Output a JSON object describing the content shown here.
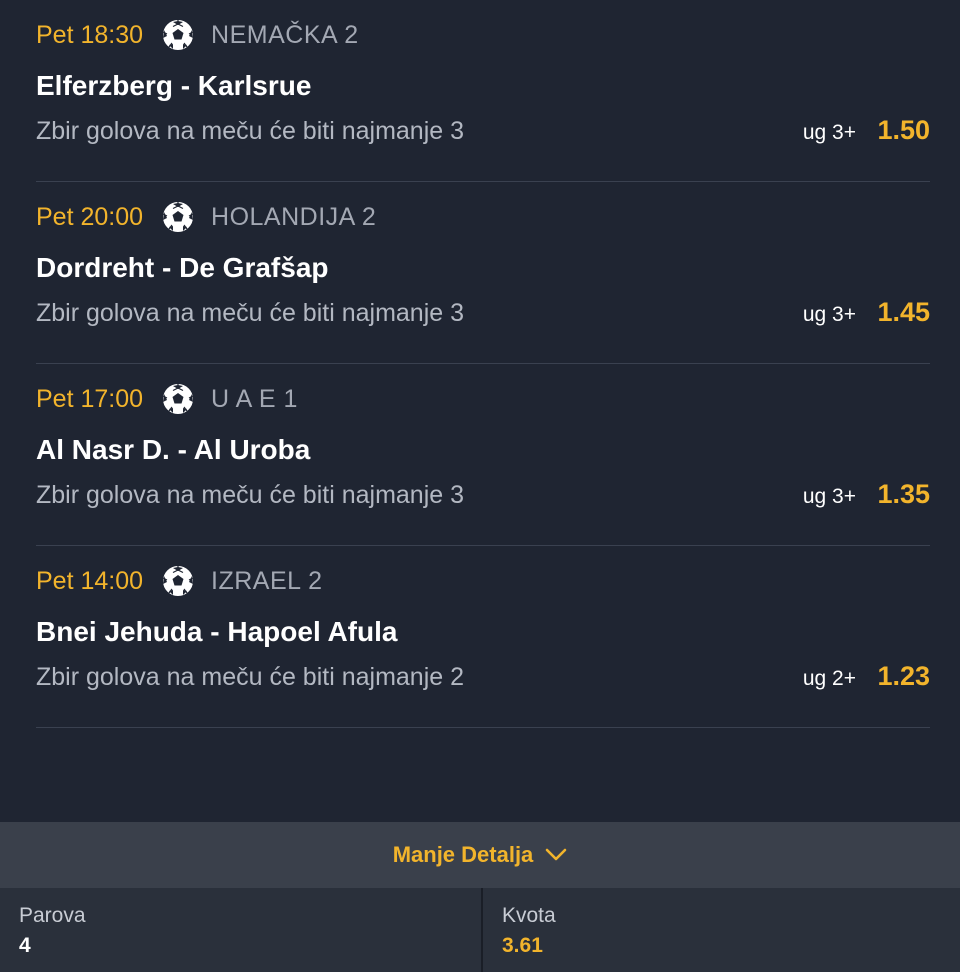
{
  "matches": [
    {
      "time": "Pet 18:30",
      "league": "NEMAČKA 2",
      "teams": "Elferzberg - Karlsrue",
      "market": "Zbir golova na meču će biti najmanje 3",
      "pick": "ug 3+",
      "odd": "1.50",
      "sport_icon": "soccer-ball-icon"
    },
    {
      "time": "Pet 20:00",
      "league": "HOLANDIJA 2",
      "teams": "Dordreht - De Grafšap",
      "market": "Zbir golova na meču će biti najmanje 3",
      "pick": "ug 3+",
      "odd": "1.45",
      "sport_icon": "soccer-ball-icon"
    },
    {
      "time": "Pet 17:00",
      "league": "U A E 1",
      "teams": "Al Nasr D. - Al Uroba",
      "market": "Zbir golova na meču će biti najmanje 3",
      "pick": "ug 3+",
      "odd": "1.35",
      "sport_icon": "soccer-ball-icon"
    },
    {
      "time": "Pet 14:00",
      "league": "IZRAEL 2",
      "teams": "Bnei Jehuda - Hapoel Afula",
      "market": "Zbir golova na meču će biti najmanje 2",
      "pick": "ug 2+",
      "odd": "1.23",
      "sport_icon": "soccer-ball-icon"
    }
  ],
  "toggle": {
    "label": "Manje Detalja",
    "icon": "chevron-down-icon"
  },
  "summary": {
    "pairs_label": "Parova",
    "pairs_value": "4",
    "odds_label": "Kvota",
    "odds_value": "3.61"
  },
  "colors": {
    "accent": "#f2b42c",
    "background": "#1f2532",
    "divider": "#3a4150"
  }
}
